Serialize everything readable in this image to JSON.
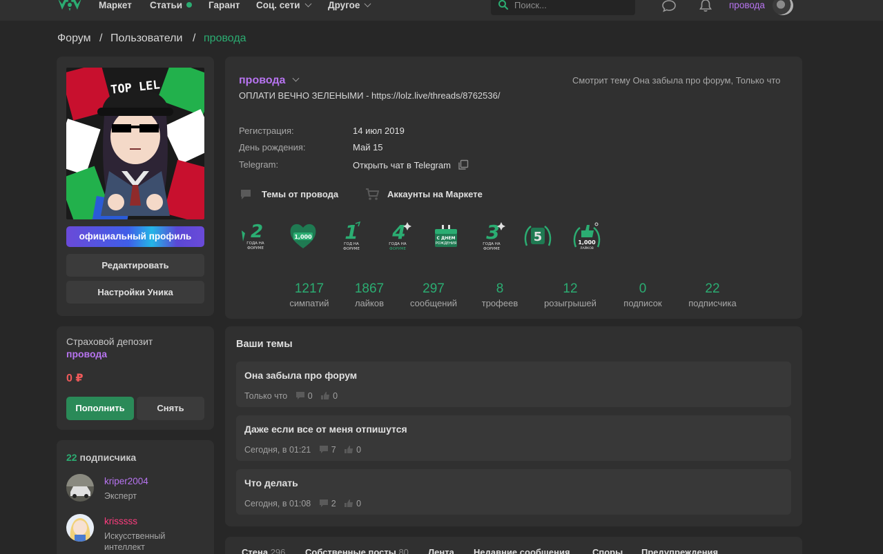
{
  "nav": {
    "items": [
      {
        "label": "Маркет"
      },
      {
        "label": "Статьи"
      },
      {
        "label": "Гарант"
      },
      {
        "label": "Соц. сети"
      },
      {
        "label": "Другое"
      }
    ],
    "search_placeholder": "Поиск...",
    "username": "провода"
  },
  "breadcrumb": {
    "items": [
      "Форум",
      "Пользователи"
    ],
    "current": "провода",
    "separator": "/"
  },
  "sidebar": {
    "official_label": "официальный профиль",
    "edit_label": "Редактировать",
    "settings_label": "Настройки Уника",
    "avatar_text": "TOP LEL",
    "deposit": {
      "title": "Страховой депозит",
      "user": "провода",
      "amount": "0 ₽",
      "topup_label": "Пополнить",
      "withdraw_label": "Снять"
    },
    "subscribers": {
      "count": "22",
      "label": "подписчика",
      "items": [
        {
          "name": "kriper2004",
          "role": "Эксперт",
          "color": "#b774f0"
        },
        {
          "name": "krisssss",
          "role": "Искусственный интеллект",
          "color": "#ff3d7f"
        }
      ]
    }
  },
  "profile": {
    "username": "провода",
    "status_right": "Смотрит тему Она забыла про форум, Только что",
    "quote": "ОПЛАТИ ВЕЧНО ЗЕЛЕНЫМИ - https://lolz.live/threads/8762536/",
    "info": [
      {
        "label": "Регистрация:",
        "value": "14 июл 2019"
      },
      {
        "label": "День рождения:",
        "value": "Май 15"
      },
      {
        "label": "Telegram:",
        "value": "Открыть чат в Telegram"
      }
    ],
    "links": [
      {
        "label": "Темы от провода"
      },
      {
        "label": "Аккаунты на Маркете"
      }
    ],
    "trophies": [
      {
        "text": "2",
        "sub": "ГОДА НА ФОРУМЕ"
      },
      {
        "text": "1,000",
        "sub": ""
      },
      {
        "text": "1",
        "sub": "ГОД НА ФОРУМЕ"
      },
      {
        "text": "4",
        "sub": "ГОДА НА ФОРУМЕ"
      },
      {
        "text": "С ДНЕМ",
        "sub": "РОЖДЕНИЯ"
      },
      {
        "text": "3",
        "sub": "ГОДА НА ФОРУМЕ"
      },
      {
        "text": "5",
        "sub": ""
      },
      {
        "text": "1,000",
        "sub": "ЛАЙКОВ"
      }
    ],
    "stats": [
      {
        "value": "1217",
        "label": "симпатий"
      },
      {
        "value": "1867",
        "label": "лайков"
      },
      {
        "value": "297",
        "label": "сообщений"
      },
      {
        "value": "8",
        "label": "трофеев"
      },
      {
        "value": "12",
        "label": "розыгрышей"
      },
      {
        "value": "0",
        "label": "подписок"
      },
      {
        "value": "22",
        "label": "подписчика"
      }
    ]
  },
  "themes": {
    "title": "Ваши темы",
    "items": [
      {
        "title": "Она забыла про форум",
        "time": "Только что",
        "comments": "0",
        "likes": "0"
      },
      {
        "title": "Даже если все от меня отпишутся",
        "time": "Сегодня, в 01:21",
        "comments": "7",
        "likes": "0"
      },
      {
        "title": "Что делать",
        "time": "Сегодня, в 01:08",
        "comments": "2",
        "likes": "0"
      }
    ]
  },
  "tabs": [
    {
      "label": "Стена",
      "count": "296"
    },
    {
      "label": "Собственные посты",
      "count": "80"
    },
    {
      "label": "Лента",
      "count": ""
    },
    {
      "label": "Недавние сообщения",
      "count": ""
    },
    {
      "label": "Споры",
      "count": ""
    },
    {
      "label": "Предупреждения",
      "count": ""
    }
  ],
  "colors": {
    "accent_green": "#2bad72",
    "username_purple": "#b774f0",
    "deposit_red": "#f05a5a",
    "background": "#272727",
    "panel": "#303030"
  }
}
